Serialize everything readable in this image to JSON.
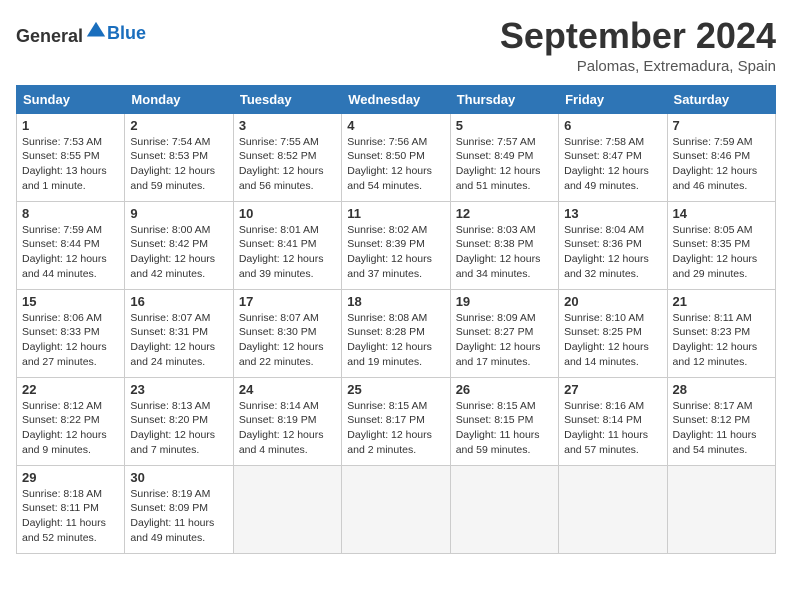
{
  "header": {
    "logo_general": "General",
    "logo_blue": "Blue",
    "month_year": "September 2024",
    "location": "Palomas, Extremadura, Spain"
  },
  "calendar": {
    "days_of_week": [
      "Sunday",
      "Monday",
      "Tuesday",
      "Wednesday",
      "Thursday",
      "Friday",
      "Saturday"
    ],
    "weeks": [
      [
        {
          "day": "",
          "empty": true
        },
        {
          "day": "",
          "empty": true
        },
        {
          "day": "",
          "empty": true
        },
        {
          "day": "",
          "empty": true
        },
        {
          "day": "",
          "empty": true
        },
        {
          "day": "",
          "empty": true
        },
        {
          "day": "",
          "empty": true
        }
      ],
      [
        {
          "day": "1",
          "sunrise": "7:53 AM",
          "sunset": "8:55 PM",
          "daylight": "13 hours and 1 minute."
        },
        {
          "day": "2",
          "sunrise": "7:54 AM",
          "sunset": "8:53 PM",
          "daylight": "12 hours and 59 minutes."
        },
        {
          "day": "3",
          "sunrise": "7:55 AM",
          "sunset": "8:52 PM",
          "daylight": "12 hours and 56 minutes."
        },
        {
          "day": "4",
          "sunrise": "7:56 AM",
          "sunset": "8:50 PM",
          "daylight": "12 hours and 54 minutes."
        },
        {
          "day": "5",
          "sunrise": "7:57 AM",
          "sunset": "8:49 PM",
          "daylight": "12 hours and 51 minutes."
        },
        {
          "day": "6",
          "sunrise": "7:58 AM",
          "sunset": "8:47 PM",
          "daylight": "12 hours and 49 minutes."
        },
        {
          "day": "7",
          "sunrise": "7:59 AM",
          "sunset": "8:46 PM",
          "daylight": "12 hours and 46 minutes."
        }
      ],
      [
        {
          "day": "8",
          "sunrise": "7:59 AM",
          "sunset": "8:44 PM",
          "daylight": "12 hours and 44 minutes."
        },
        {
          "day": "9",
          "sunrise": "8:00 AM",
          "sunset": "8:42 PM",
          "daylight": "12 hours and 42 minutes."
        },
        {
          "day": "10",
          "sunrise": "8:01 AM",
          "sunset": "8:41 PM",
          "daylight": "12 hours and 39 minutes."
        },
        {
          "day": "11",
          "sunrise": "8:02 AM",
          "sunset": "8:39 PM",
          "daylight": "12 hours and 37 minutes."
        },
        {
          "day": "12",
          "sunrise": "8:03 AM",
          "sunset": "8:38 PM",
          "daylight": "12 hours and 34 minutes."
        },
        {
          "day": "13",
          "sunrise": "8:04 AM",
          "sunset": "8:36 PM",
          "daylight": "12 hours and 32 minutes."
        },
        {
          "day": "14",
          "sunrise": "8:05 AM",
          "sunset": "8:35 PM",
          "daylight": "12 hours and 29 minutes."
        }
      ],
      [
        {
          "day": "15",
          "sunrise": "8:06 AM",
          "sunset": "8:33 PM",
          "daylight": "12 hours and 27 minutes."
        },
        {
          "day": "16",
          "sunrise": "8:07 AM",
          "sunset": "8:31 PM",
          "daylight": "12 hours and 24 minutes."
        },
        {
          "day": "17",
          "sunrise": "8:07 AM",
          "sunset": "8:30 PM",
          "daylight": "12 hours and 22 minutes."
        },
        {
          "day": "18",
          "sunrise": "8:08 AM",
          "sunset": "8:28 PM",
          "daylight": "12 hours and 19 minutes."
        },
        {
          "day": "19",
          "sunrise": "8:09 AM",
          "sunset": "8:27 PM",
          "daylight": "12 hours and 17 minutes."
        },
        {
          "day": "20",
          "sunrise": "8:10 AM",
          "sunset": "8:25 PM",
          "daylight": "12 hours and 14 minutes."
        },
        {
          "day": "21",
          "sunrise": "8:11 AM",
          "sunset": "8:23 PM",
          "daylight": "12 hours and 12 minutes."
        }
      ],
      [
        {
          "day": "22",
          "sunrise": "8:12 AM",
          "sunset": "8:22 PM",
          "daylight": "12 hours and 9 minutes."
        },
        {
          "day": "23",
          "sunrise": "8:13 AM",
          "sunset": "8:20 PM",
          "daylight": "12 hours and 7 minutes."
        },
        {
          "day": "24",
          "sunrise": "8:14 AM",
          "sunset": "8:19 PM",
          "daylight": "12 hours and 4 minutes."
        },
        {
          "day": "25",
          "sunrise": "8:15 AM",
          "sunset": "8:17 PM",
          "daylight": "12 hours and 2 minutes."
        },
        {
          "day": "26",
          "sunrise": "8:15 AM",
          "sunset": "8:15 PM",
          "daylight": "11 hours and 59 minutes."
        },
        {
          "day": "27",
          "sunrise": "8:16 AM",
          "sunset": "8:14 PM",
          "daylight": "11 hours and 57 minutes."
        },
        {
          "day": "28",
          "sunrise": "8:17 AM",
          "sunset": "8:12 PM",
          "daylight": "11 hours and 54 minutes."
        }
      ],
      [
        {
          "day": "29",
          "sunrise": "8:18 AM",
          "sunset": "8:11 PM",
          "daylight": "11 hours and 52 minutes."
        },
        {
          "day": "30",
          "sunrise": "8:19 AM",
          "sunset": "8:09 PM",
          "daylight": "11 hours and 49 minutes."
        },
        {
          "day": "",
          "empty": true
        },
        {
          "day": "",
          "empty": true
        },
        {
          "day": "",
          "empty": true
        },
        {
          "day": "",
          "empty": true
        },
        {
          "day": "",
          "empty": true
        }
      ]
    ]
  }
}
